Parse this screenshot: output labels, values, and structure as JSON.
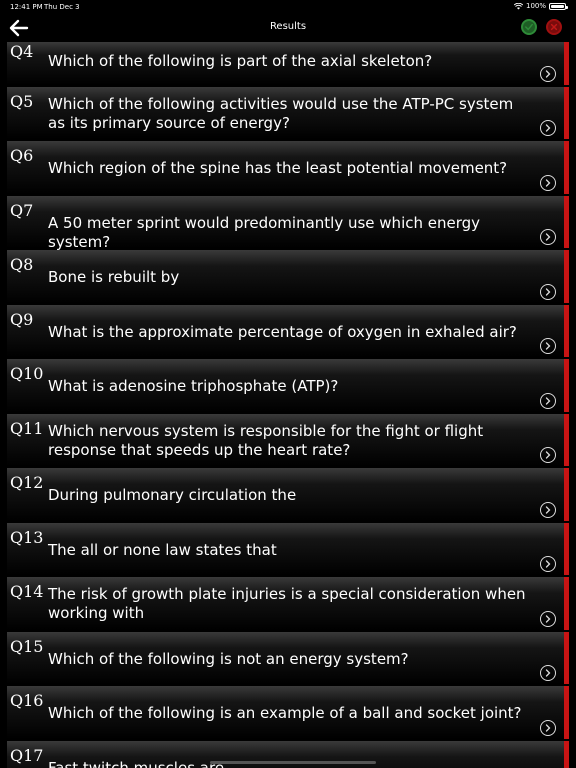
{
  "status": {
    "time": "12:41 PM",
    "date": "Thu Dec 3",
    "battery": "100%",
    "battery_level": 1.0
  },
  "nav": {
    "title": "Results"
  },
  "questions": [
    {
      "num": "Q4",
      "text": "Which of the following is part of the axial skeleton?"
    },
    {
      "num": "Q5",
      "text": "Which of the following activities would use the ATP-PC system as its primary source of energy?"
    },
    {
      "num": "Q6",
      "text": "Which region of the spine has the least potential movement?"
    },
    {
      "num": "Q7",
      "text": "A 50 meter sprint would predominantly use which energy system?"
    },
    {
      "num": "Q8",
      "text": "Bone is rebuilt by"
    },
    {
      "num": "Q9",
      "text": "What is the approximate percentage of oxygen in exhaled air?"
    },
    {
      "num": "Q10",
      "text": "What is adenosine triphosphate (ATP)?"
    },
    {
      "num": "Q11",
      "text": "Which nervous system is responsible for the fight or flight response that speeds up the heart rate?"
    },
    {
      "num": "Q12",
      "text": "During pulmonary circulation the"
    },
    {
      "num": "Q13",
      "text": "The all or none law states that"
    },
    {
      "num": "Q14",
      "text": "The risk of growth plate injuries is a special consideration when working with"
    },
    {
      "num": "Q15",
      "text": "Which of the following is not an energy system?"
    },
    {
      "num": "Q16",
      "text": "Which of the following is an example of a ball and socket joint?"
    },
    {
      "num": "Q17",
      "text": "Fast twitch muscles are"
    }
  ],
  "icons": {
    "back": "back-arrow-icon",
    "correct": "check-icon",
    "incorrect": "close-icon",
    "row": "chevron-right-icon"
  },
  "colors": {
    "incorrect": "#c81414",
    "correct": "#2e8b38"
  }
}
